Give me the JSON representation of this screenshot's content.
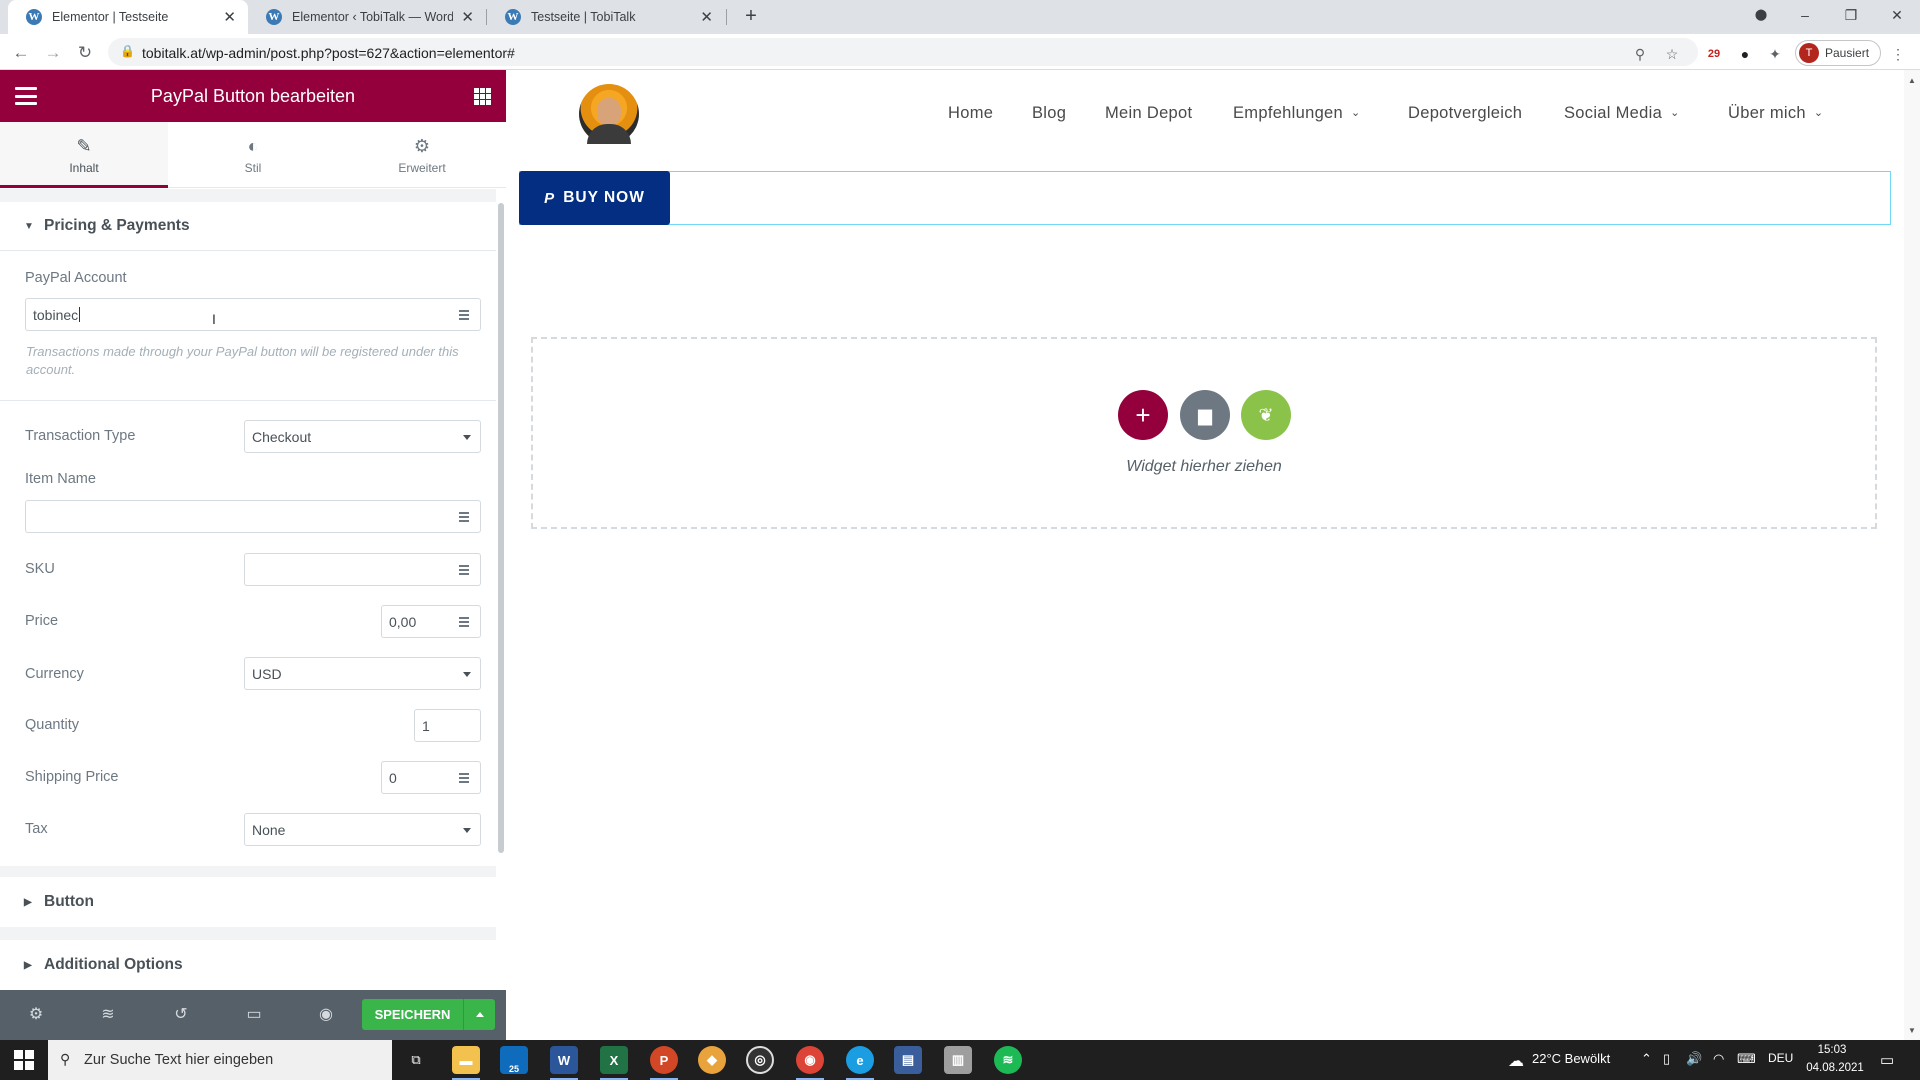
{
  "browser": {
    "tabs": [
      {
        "title": "Elementor | Testseite",
        "active": true
      },
      {
        "title": "Elementor ‹ TobiTalk — WordPre",
        "active": false
      },
      {
        "title": "Testseite | TobiTalk",
        "active": false
      }
    ],
    "close_glyph": "✕",
    "new_tab_glyph": "+",
    "url": "tobitalk.at/wp-admin/post.php?post=627&action=elementor#",
    "profile_initial": "T",
    "profile_label": "Pausiert",
    "ext_badge": "29"
  },
  "panel": {
    "title": "PayPal Button bearbeiten",
    "tabs": [
      {
        "label": "Inhalt",
        "icon": "pencil-icon"
      },
      {
        "label": "Stil",
        "icon": "half-circle-icon"
      },
      {
        "label": "Erweitert",
        "icon": "gear-icon"
      }
    ],
    "sections": {
      "pricing": "Pricing & Payments",
      "button": "Button",
      "additional": "Additional Options"
    },
    "fields": {
      "paypal_account_label": "PayPal Account",
      "paypal_account_value": "tobinec",
      "paypal_account_hint": "Transactions made through your PayPal button will be registered under this account.",
      "transaction_type_label": "Transaction Type",
      "transaction_type_value": "Checkout",
      "item_name_label": "Item Name",
      "item_name_value": "",
      "sku_label": "SKU",
      "sku_value": "",
      "price_label": "Price",
      "price_value": "0,00",
      "currency_label": "Currency",
      "currency_value": "USD",
      "quantity_label": "Quantity",
      "quantity_value": "1",
      "shipping_label": "Shipping Price",
      "shipping_value": "0",
      "tax_label": "Tax",
      "tax_value": "None"
    },
    "footer": {
      "save_label": "SPEICHERN"
    }
  },
  "preview": {
    "nav": [
      "Home",
      "Blog",
      "Mein Depot",
      "Empfehlungen",
      "Depotvergleich",
      "Social Media",
      "Über mich"
    ],
    "nav_dropdown": [
      false,
      false,
      false,
      true,
      false,
      true,
      true
    ],
    "buy_now_label": "BUY NOW",
    "paypal_glyph": "P",
    "drop_hint": "Widget hierher ziehen"
  },
  "taskbar": {
    "search_placeholder": "Zur Suche Text hier eingeben",
    "mail_badge": "25",
    "weather": "22°C  Bewölkt",
    "lang": "DEU",
    "time": "15:03",
    "date": "04.08.2021"
  },
  "colors": {
    "elementor_maroon": "#93003c",
    "buy_now_bg": "#032e82",
    "save_green": "#39b54a",
    "footer_gray": "#556068"
  }
}
